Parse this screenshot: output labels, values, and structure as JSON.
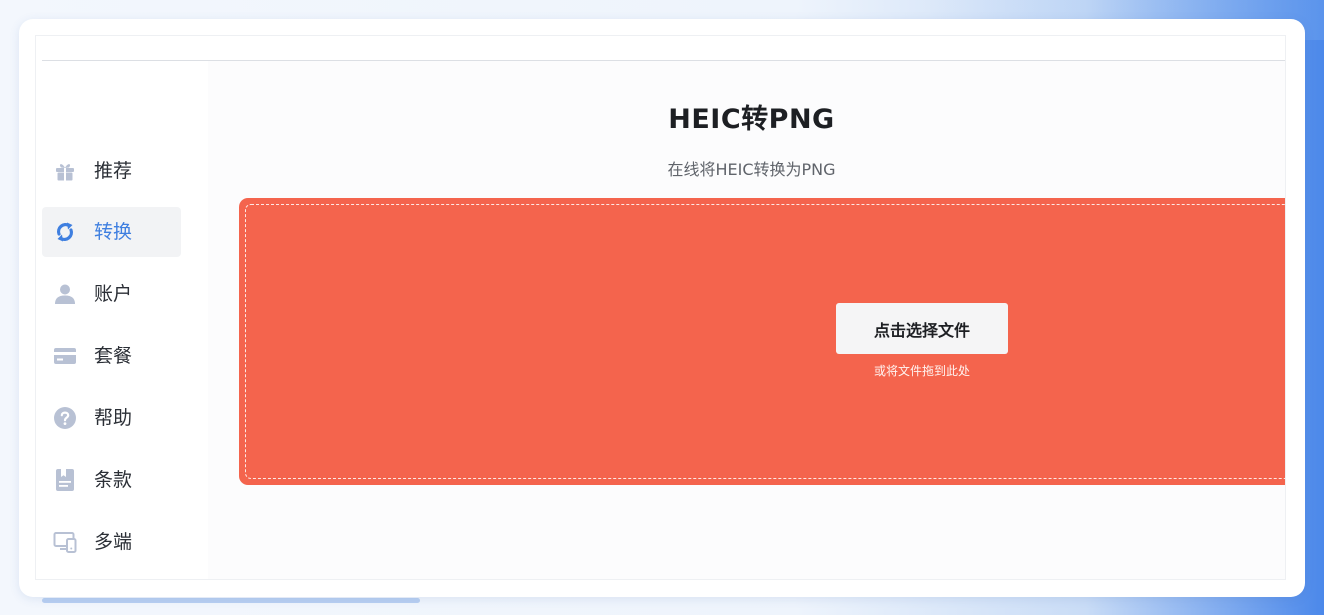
{
  "sidebar": {
    "items": [
      {
        "label": "推荐",
        "icon": "gift-icon"
      },
      {
        "label": "转换",
        "icon": "convert-icon",
        "active": true
      },
      {
        "label": "账户",
        "icon": "user-icon"
      },
      {
        "label": "套餐",
        "icon": "card-icon"
      },
      {
        "label": "帮助",
        "icon": "help-icon"
      },
      {
        "label": "条款",
        "icon": "document-icon"
      },
      {
        "label": "多端",
        "icon": "devices-icon"
      }
    ]
  },
  "main": {
    "title": "HEIC转PNG",
    "subtitle": "在线将HEIC转换为PNG",
    "dropzone": {
      "button_label": "点击选择文件",
      "hint": "或将文件拖到此处"
    }
  },
  "colors": {
    "accent": "#3f7fe0",
    "dropzone": "#f4644d",
    "icon_gray": "#b8c1d4"
  }
}
